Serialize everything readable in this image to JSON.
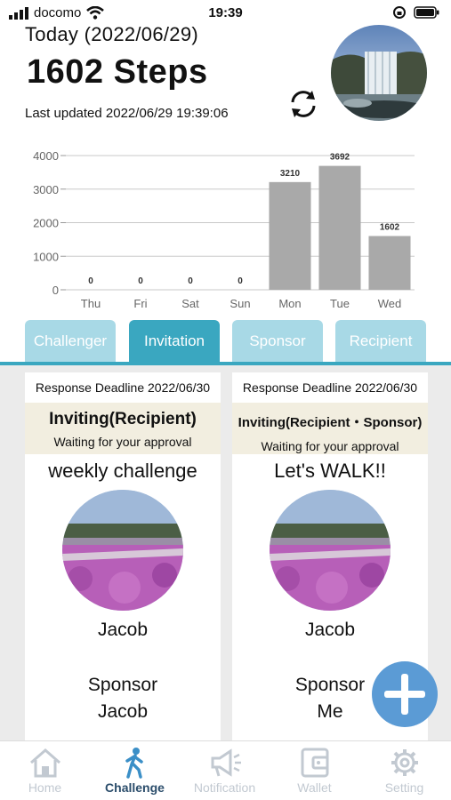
{
  "status_bar": {
    "carrier": "docomo",
    "time": "19:39"
  },
  "header": {
    "today_label": "Today (2022/06/29)",
    "steps_label": "1602 Steps",
    "last_updated": "Last updated 2022/06/29 19:39:06",
    "refresh_icon": "refresh-icon"
  },
  "chart_data": {
    "type": "bar",
    "categories": [
      "Thu",
      "Fri",
      "Sat",
      "Sun",
      "Mon",
      "Tue",
      "Wed"
    ],
    "values": [
      0,
      0,
      0,
      0,
      3210,
      3692,
      1602
    ],
    "y_ticks": [
      0,
      1000,
      2000,
      3000,
      4000
    ],
    "ylim": [
      0,
      4000
    ],
    "grid": true,
    "bar_color": "#a9a9a9"
  },
  "tabs": [
    {
      "label": "Challenger",
      "active": false
    },
    {
      "label": "Invitation",
      "active": true
    },
    {
      "label": "Sponsor",
      "active": false
    },
    {
      "label": "Recipient",
      "active": false
    }
  ],
  "cards": [
    {
      "deadline": "Response Deadline 2022/06/30",
      "status_title": "Inviting(Recipient)",
      "status_sub": "Waiting for your approval",
      "challenge_name": "weekly challenge",
      "person": "Jacob",
      "sponsor_label": "Sponsor",
      "sponsor_name": "Jacob"
    },
    {
      "deadline": "Response Deadline 2022/06/30",
      "status_title": "Inviting(Recipient・Sponsor)",
      "status_sub": "Waiting for your approval",
      "challenge_name": "Let's WALK!!",
      "person": "Jacob",
      "sponsor_label": "Sponsor",
      "sponsor_name": "Me"
    }
  ],
  "fab": {
    "icon": "plus-icon",
    "color": "#5b9bd5"
  },
  "bottom_nav": [
    {
      "label": "Home",
      "icon": "home-icon",
      "active": false
    },
    {
      "label": "Challenge",
      "icon": "walker-icon",
      "active": true
    },
    {
      "label": "Notification",
      "icon": "megaphone-icon",
      "active": false
    },
    {
      "label": "Wallet",
      "icon": "wallet-icon",
      "active": false
    },
    {
      "label": "Setting",
      "icon": "gear-icon",
      "active": false
    }
  ],
  "colors": {
    "tab_active": "#3aa7c0",
    "tab_inactive": "#a8d9e6",
    "nav_active": "#2b4d6b",
    "nav_inactive": "#c2c9d1",
    "status_box": "#f2eee0"
  }
}
